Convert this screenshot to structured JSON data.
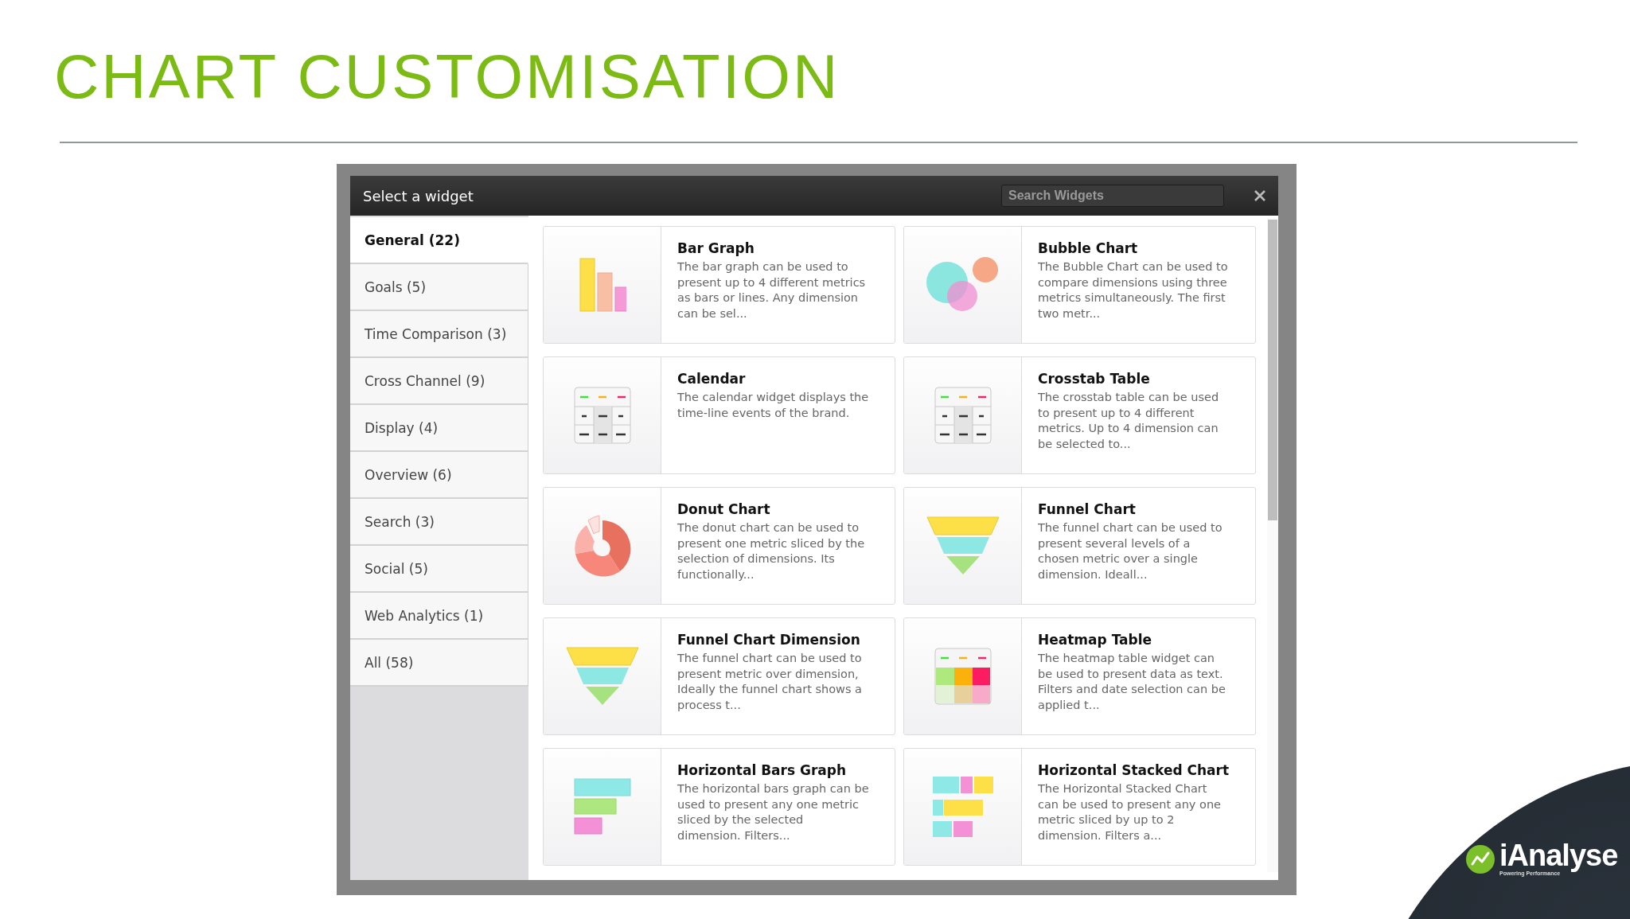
{
  "slide": {
    "title": "CHART CUSTOMISATION"
  },
  "dialog": {
    "title": "Select a widget",
    "search": {
      "placeholder": "Search Widgets"
    },
    "categories": [
      {
        "label": "General (22)",
        "selected": true
      },
      {
        "label": "Goals (5)",
        "selected": false
      },
      {
        "label": "Time Comparison (3)",
        "selected": false
      },
      {
        "label": "Cross Channel (9)",
        "selected": false
      },
      {
        "label": "Display (4)",
        "selected": false
      },
      {
        "label": "Overview (6)",
        "selected": false
      },
      {
        "label": "Search (3)",
        "selected": false
      },
      {
        "label": "Social (5)",
        "selected": false
      },
      {
        "label": "Web Analytics (1)",
        "selected": false
      },
      {
        "label": "All (58)",
        "selected": false
      }
    ],
    "widgets": [
      {
        "kind": "bar",
        "name": "Bar Graph",
        "description": "The bar graph can be used to present up to 4 different metrics as bars or lines. Any dimension can be sel..."
      },
      {
        "kind": "bubble",
        "name": "Bubble Chart",
        "description": "The Bubble Chart can be used to compare dimensions using three metrics simultaneously. The first two metr..."
      },
      {
        "kind": "table",
        "name": "Calendar",
        "description": "The calendar widget displays the time-line events of the brand."
      },
      {
        "kind": "table",
        "name": "Crosstab Table",
        "description": "The crosstab table can be used to present up to 4 different metrics. Up to 4 dimension can be selected to..."
      },
      {
        "kind": "donut",
        "name": "Donut Chart",
        "description": "The donut chart can be used to present one metric sliced by the selection of dimensions. Its functionally..."
      },
      {
        "kind": "funnel",
        "name": "Funnel Chart",
        "description": "The funnel chart can be used to present several levels of a chosen metric over a single dimension. Ideall..."
      },
      {
        "kind": "funnel",
        "name": "Funnel Chart Dimension",
        "description": "The funnel chart can be used to present metric over dimension, Ideally the funnel chart shows a process t..."
      },
      {
        "kind": "heatmap",
        "name": "Heatmap Table",
        "description": "The heatmap table widget can be used to present data as text. Filters and date selection can be applied t..."
      },
      {
        "kind": "hbars",
        "name": "Horizontal Bars Graph",
        "description": "The horizontal bars graph can be used to present any one metric sliced by the selected dimension. Filters..."
      },
      {
        "kind": "hstacked",
        "name": "Horizontal Stacked Chart",
        "description": "The Horizontal Stacked Chart can be used to present any one metric sliced by up to 2 dimension. Filters a..."
      }
    ]
  },
  "logo": {
    "name": "iAnalyse",
    "tagline": "Powering Performance"
  }
}
